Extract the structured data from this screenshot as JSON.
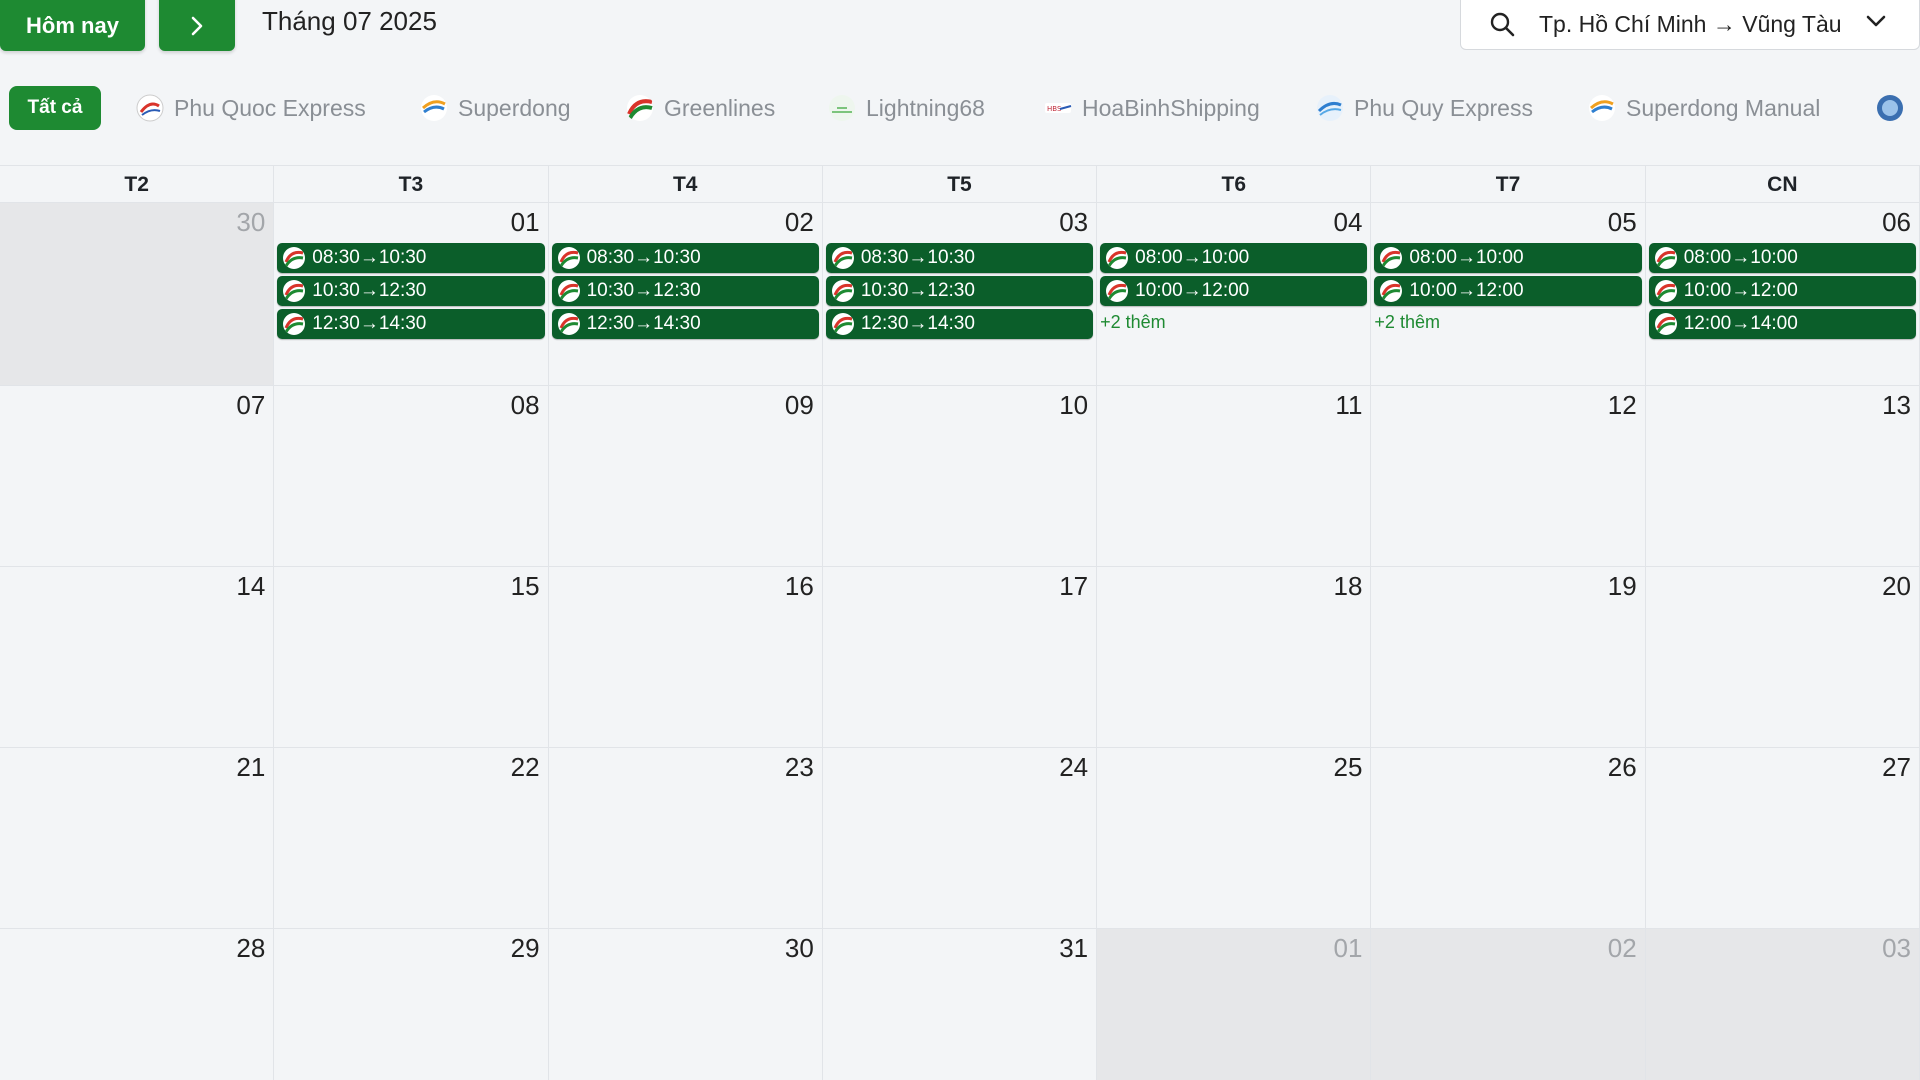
{
  "header": {
    "today_label": "Hôm nay",
    "month_title": "Tháng 07 2025",
    "route": "Tp. Hồ Chí Minh → Vũng Tàu"
  },
  "filters": {
    "all_label": "Tất cả",
    "operators": [
      {
        "name": "Phu Quoc Express",
        "icon": "phu-quoc-express-logo"
      },
      {
        "name": "Superdong",
        "icon": "superdong-logo"
      },
      {
        "name": "Greenlines",
        "icon": "greenlines-logo"
      },
      {
        "name": "Lightning68",
        "icon": "lightning68-logo"
      },
      {
        "name": "HoaBinhShipping",
        "icon": "hoabinh-shipping-logo"
      },
      {
        "name": "Phu Quy Express",
        "icon": "phu-quy-express-logo"
      },
      {
        "name": "Superdong Manual",
        "icon": "superdong-manual-logo"
      }
    ]
  },
  "weekdays": [
    "T2",
    "T3",
    "T4",
    "T5",
    "T6",
    "T7",
    "CN"
  ],
  "colors": {
    "accent": "#1e8a32",
    "event": "#0b5e2a",
    "muted_cell": "#e6e7e9"
  },
  "weeks": [
    [
      {
        "day": "30",
        "muted": true,
        "events": []
      },
      {
        "day": "01",
        "events": [
          "08:30→10:30",
          "10:30→12:30",
          "12:30→14:30"
        ]
      },
      {
        "day": "02",
        "events": [
          "08:30→10:30",
          "10:30→12:30",
          "12:30→14:30"
        ]
      },
      {
        "day": "03",
        "events": [
          "08:30→10:30",
          "10:30→12:30",
          "12:30→14:30"
        ]
      },
      {
        "day": "04",
        "events": [
          "08:00→10:00",
          "10:00→12:00"
        ],
        "more": "+2 thêm"
      },
      {
        "day": "05",
        "events": [
          "08:00→10:00",
          "10:00→12:00"
        ],
        "more": "+2 thêm"
      },
      {
        "day": "06",
        "events": [
          "08:00→10:00",
          "10:00→12:00",
          "12:00→14:00"
        ]
      }
    ],
    [
      {
        "day": "07",
        "events": []
      },
      {
        "day": "08",
        "events": []
      },
      {
        "day": "09",
        "events": []
      },
      {
        "day": "10",
        "events": []
      },
      {
        "day": "11",
        "events": []
      },
      {
        "day": "12",
        "events": []
      },
      {
        "day": "13",
        "events": []
      }
    ],
    [
      {
        "day": "14",
        "events": []
      },
      {
        "day": "15",
        "events": []
      },
      {
        "day": "16",
        "events": []
      },
      {
        "day": "17",
        "events": []
      },
      {
        "day": "18",
        "events": []
      },
      {
        "day": "19",
        "events": []
      },
      {
        "day": "20",
        "events": []
      }
    ],
    [
      {
        "day": "21",
        "events": []
      },
      {
        "day": "22",
        "events": []
      },
      {
        "day": "23",
        "events": []
      },
      {
        "day": "24",
        "events": []
      },
      {
        "day": "25",
        "events": []
      },
      {
        "day": "26",
        "events": []
      },
      {
        "day": "27",
        "events": []
      }
    ],
    [
      {
        "day": "28",
        "events": []
      },
      {
        "day": "29",
        "events": []
      },
      {
        "day": "30",
        "events": []
      },
      {
        "day": "31",
        "events": []
      },
      {
        "day": "01",
        "muted": true,
        "events": []
      },
      {
        "day": "02",
        "muted": true,
        "events": []
      },
      {
        "day": "03",
        "muted": true,
        "events": []
      }
    ]
  ]
}
